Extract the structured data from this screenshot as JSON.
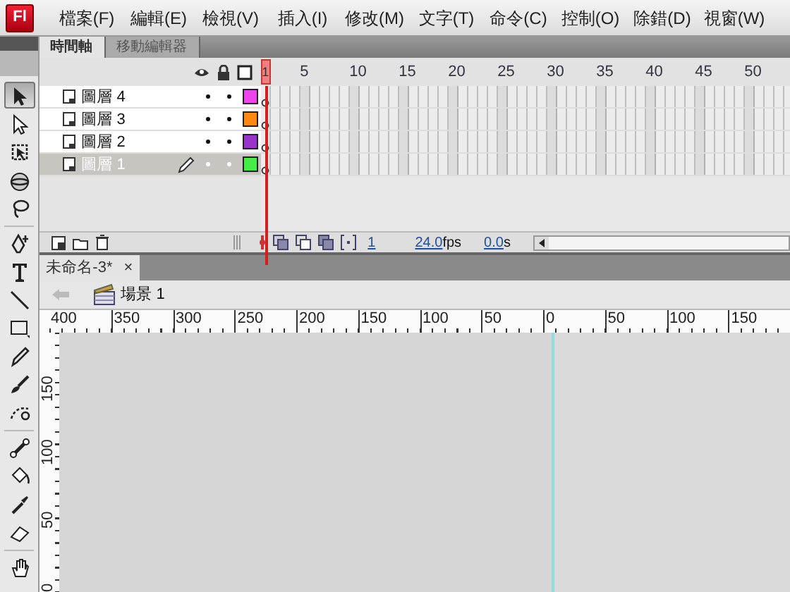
{
  "app": {
    "logo": "Fl"
  },
  "menu": {
    "items": [
      "檔案(F)",
      "編輯(E)",
      "檢視(V)",
      "插入(I)",
      "修改(M)",
      "文字(T)",
      "命令(C)",
      "控制(O)",
      "除錯(D)",
      "視窗(W)"
    ]
  },
  "tools": [
    {
      "selected": true
    },
    {
      "selected": false
    },
    {
      "selected": false
    },
    {
      "selected": false
    },
    {
      "selected": false
    },
    {
      "selected": false
    },
    {
      "selected": false
    },
    {
      "selected": false
    },
    {
      "selected": false
    },
    {
      "selected": false
    },
    {
      "selected": false
    },
    {
      "selected": false
    },
    {
      "selected": false
    },
    {
      "selected": false
    },
    {
      "selected": false
    },
    {
      "selected": false
    },
    {
      "selected": false
    }
  ],
  "timeline": {
    "tabs": [
      {
        "label": "時間軸",
        "selected": true
      },
      {
        "label": "移動編輯器",
        "selected": false
      }
    ],
    "frame_numbers": [
      "1",
      "5",
      "10",
      "15",
      "20",
      "25",
      "30",
      "35",
      "40",
      "45",
      "50"
    ],
    "layers": [
      {
        "name": "圖層 4",
        "selected": false,
        "visible": true,
        "locked": false,
        "color": "#ee44ee"
      },
      {
        "name": "圖層 3",
        "selected": false,
        "visible": true,
        "locked": false,
        "color": "#ff8811"
      },
      {
        "name": "圖層 2",
        "selected": false,
        "visible": true,
        "locked": false,
        "color": "#9933cc"
      },
      {
        "name": "圖層 1",
        "selected": true,
        "visible": true,
        "locked": false,
        "color": "#44ee44"
      }
    ],
    "status": {
      "current_frame": "1",
      "fps": "24.0",
      "fps_unit": "fps",
      "time": "0.0",
      "time_unit": "s"
    }
  },
  "document_tab": {
    "title": "未命名-3*",
    "close": "×"
  },
  "edit_bar": {
    "scene": "場景 1"
  },
  "stage": {
    "top_ruler": [
      "400",
      "350",
      "300",
      "250",
      "200",
      "150",
      "100",
      "50",
      "0",
      "50",
      "100",
      "150"
    ],
    "left_ruler": [
      "150",
      "100",
      "50",
      "0"
    ]
  }
}
